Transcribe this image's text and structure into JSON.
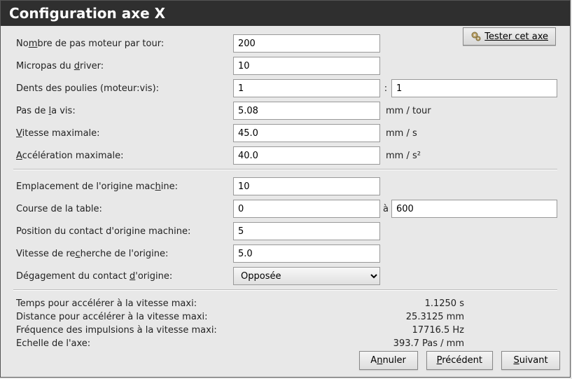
{
  "title": "Configuration axe X",
  "test_button": "Tester cet axe",
  "section1": {
    "steps_per_rev": {
      "label_pre": "No",
      "label_u": "m",
      "label_post": "bre de pas moteur par tour:",
      "value": "200"
    },
    "microstep": {
      "label_pre": "Micropas du ",
      "label_u": "d",
      "label_post": "river:",
      "value": "10"
    },
    "pulley": {
      "label": "Dents des poulies (moteur:vis):",
      "left": "1",
      "sep": ":",
      "right": "1"
    },
    "pitch": {
      "label_pre": "Pas de ",
      "label_u": "l",
      "label_post": "a vis:",
      "value": "5.08",
      "unit": "mm / tour"
    },
    "vmax": {
      "label_u": "V",
      "label_post": "itesse maximale:",
      "value": "45.0",
      "unit": "mm / s"
    },
    "amax": {
      "label_u": "A",
      "label_post": "ccélération maximale:",
      "value": "40.0",
      "unit": "mm / s²"
    }
  },
  "section2": {
    "home_loc": {
      "label_pre": "Emplacement de l'origine mac",
      "label_u": "h",
      "label_post": "ine:",
      "value": "10"
    },
    "travel": {
      "label": "Course de la table:",
      "left": "0",
      "sep": "à",
      "right": "600"
    },
    "home_sw_pos": {
      "label": "Position du contact d'origine machine:",
      "value": "5"
    },
    "home_search_v": {
      "label_pre": "Vitesse de re",
      "label_u": "c",
      "label_post": "herche de l'origine:",
      "value": "5.0"
    },
    "latch_dir": {
      "label_pre": "Dégagement du contact ",
      "label_u": "d",
      "label_post": "'origine:",
      "value": "Opposée"
    }
  },
  "stats": {
    "accel_time": {
      "label": "Temps pour accélérer à la vitesse maxi:",
      "value": "1.1250 s"
    },
    "accel_dist": {
      "label": "Distance pour accélérer à la vitesse maxi:",
      "value": "25.3125 mm"
    },
    "pulse_freq": {
      "label": "Fréquence des impulsions à la vitesse maxi:",
      "value": "17716.5 Hz"
    },
    "scale": {
      "label": "Echelle de l'axe:",
      "value": "393.7 Pas / mm"
    }
  },
  "buttons": {
    "cancel": {
      "pre": "A",
      "u": "n",
      "post": "nuler"
    },
    "prev": {
      "pre": "",
      "u": "P",
      "post": "récédent"
    },
    "next": {
      "pre": "",
      "u": "S",
      "post": "uivant"
    }
  }
}
